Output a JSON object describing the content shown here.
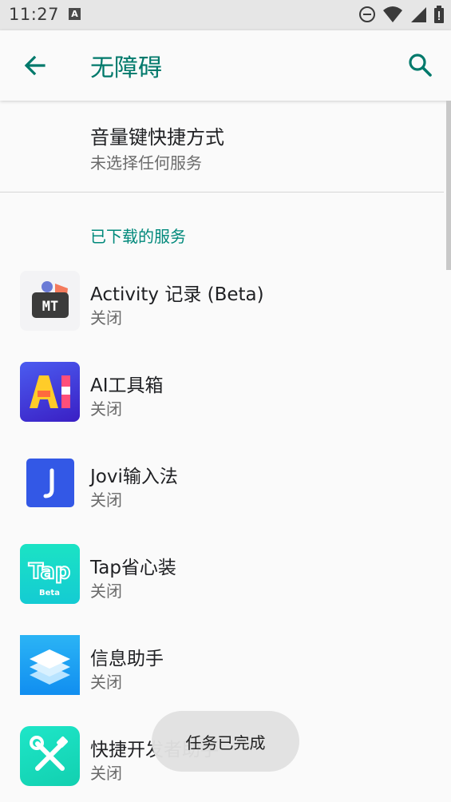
{
  "status_bar": {
    "time": "11:27",
    "notif_badge": "A"
  },
  "app_bar": {
    "title": "无障碍"
  },
  "volume_shortcut": {
    "title": "音量键快捷方式",
    "subtitle": "未选择任何服务"
  },
  "section": {
    "header": "已下载的服务"
  },
  "services": [
    {
      "name": "Activity 记录 (Beta)",
      "state": "关闭",
      "icon": "activity-record-icon",
      "icon_text": "MT"
    },
    {
      "name": "AI工具箱",
      "state": "关闭",
      "icon": "ai-toolbox-icon",
      "icon_text": "AI"
    },
    {
      "name": "Jovi输入法",
      "state": "关闭",
      "icon": "jovi-input-icon",
      "icon_text": "J"
    },
    {
      "name": "Tap省心装",
      "state": "关闭",
      "icon": "tap-install-icon",
      "icon_text": "Tap",
      "icon_sub": "Beta"
    },
    {
      "name": "信息助手",
      "state": "关闭",
      "icon": "info-assistant-icon"
    },
    {
      "name": "快捷开发者助手",
      "state": "关闭",
      "icon": "dev-tools-icon"
    }
  ],
  "toast": {
    "text": "任务已完成"
  },
  "colors": {
    "accent": "#00796b",
    "section": "#00897b"
  }
}
